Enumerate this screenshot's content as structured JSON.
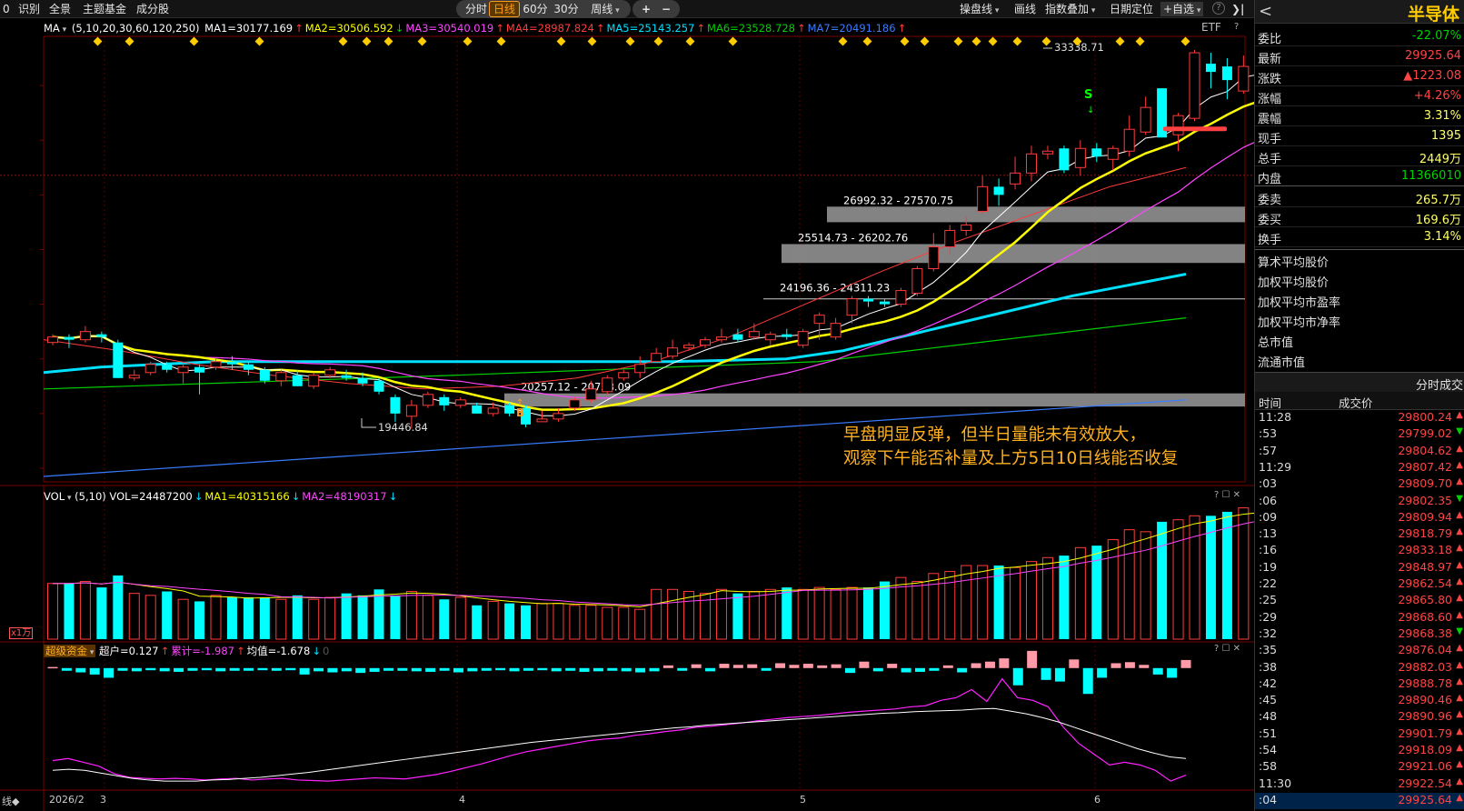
{
  "toolbar": {
    "left_items": [
      "0",
      "识别",
      "全景",
      "主题基金",
      "成分股"
    ],
    "periods": [
      "分时",
      "日线",
      "60分",
      "30分",
      "周线"
    ],
    "active_period": "日线",
    "zoom": [
      "+",
      "−"
    ],
    "right_items": [
      "操盘线",
      "画线",
      "指数叠加",
      "日期定位",
      "+自选"
    ],
    "help": "?",
    "collapse": "❯|"
  },
  "main_chart": {
    "indicator_name": "MA",
    "params": "(5,10,20,30,60,120,250)",
    "ma_values": [
      {
        "label": "MA1=30177.169",
        "arrow": "↑",
        "color": "#ffffff"
      },
      {
        "label": "MA2=30506.592",
        "arrow": "↓",
        "color": "#ffff00"
      },
      {
        "label": "MA3=30540.019",
        "arrow": "↑",
        "color": "#ff44ff"
      },
      {
        "label": "MA4=28987.824",
        "arrow": "↑",
        "color": "#ff3b3b"
      },
      {
        "label": "MA5=25143.257",
        "arrow": "↑",
        "color": "#00e0ff"
      },
      {
        "label": "MA6=23528.728",
        "arrow": "↑",
        "color": "#00d000"
      },
      {
        "label": "MA7=20491.186",
        "arrow": "↑",
        "color": "#3a7cff"
      }
    ],
    "instrument_type": "ETF",
    "y_ticks": [
      "32000",
      "30000",
      "28000",
      "26000",
      "24000",
      "22000",
      "20000",
      "18000"
    ],
    "high_label": "33338.71",
    "low_label": "19446.84",
    "zones": [
      "26992.32 - 27570.75",
      "25514.73 - 26202.76",
      "24196.36 - 24311.23",
      "20257.12 - 20738.09"
    ],
    "buy_marker": "B",
    "sell_marker": "S",
    "annotation_line1": "早盘明显反弹，但半日量能未有效放大，",
    "annotation_line2": "观察下午能否补量及上方5日10日线能否收复"
  },
  "volume_chart": {
    "indicator_name": "VOL",
    "params": "(5,10)",
    "values": [
      {
        "label": "VOL=24487200",
        "arrow": "↓",
        "color": "#ffffff"
      },
      {
        "label": "MA1=40315166",
        "arrow": "↓",
        "color": "#ffff00"
      },
      {
        "label": "MA2=48190317",
        "arrow": "↓",
        "color": "#ff44ff"
      }
    ],
    "y_ticks": [
      "6000",
      "4000",
      "2000"
    ],
    "unit_badge": "x1万"
  },
  "capital_chart": {
    "indicator_name": "超级资金",
    "values": [
      {
        "label": "超户=0.127",
        "arrow": "↑",
        "color": "#ffffff"
      },
      {
        "label": "累计=-1.987",
        "arrow": "↑",
        "color": "#ff44ff"
      },
      {
        "label": "均值=-1.678",
        "arrow": "↓",
        "color": "#ffffff"
      },
      {
        "label": "0",
        "arrow": "",
        "color": "#555555"
      }
    ],
    "y_ticks": [
      "0",
      "-1",
      "-2"
    ]
  },
  "x_axis": {
    "start_label": "2026/2",
    "labels": [
      "3",
      "4",
      "5",
      "6"
    ],
    "left_edge": "线◆"
  },
  "quote_panel": {
    "title": "半导体",
    "rows": [
      {
        "key": "委比",
        "value": "-22.07%",
        "color": "#00d000"
      },
      {
        "key": "最新",
        "value": "29925.64",
        "color": "#ff4444"
      },
      {
        "key": "涨跌",
        "value": "▲1223.08",
        "color": "#ff4444"
      },
      {
        "key": "涨幅",
        "value": "+4.26%",
        "color": "#ff4444"
      },
      {
        "key": "震幅",
        "value": "3.31%",
        "color": "#ffff66"
      },
      {
        "key": "现手",
        "value": "1395",
        "color": "#ffff66"
      },
      {
        "key": "总手",
        "value": "2449万",
        "color": "#ffff66"
      },
      {
        "key": "内盘",
        "value": "11366010",
        "color": "#00d000"
      },
      {
        "key": "委卖",
        "value": "265.7万",
        "color": "#ffff66"
      },
      {
        "key": "委买",
        "value": "169.6万",
        "color": "#ffff66"
      },
      {
        "key": "换手",
        "value": "3.14%",
        "color": "#ffff66"
      }
    ],
    "metrics": [
      "算术平均股价",
      "加权平均股价",
      "加权平均市盈率",
      "加权平均市净率",
      "总市值",
      "流通市值"
    ],
    "ticks_header": "分时成交",
    "ticks_columns": [
      "时间",
      "成交价"
    ],
    "ticks": [
      {
        "time": "11:28",
        "price": "29800.24",
        "dir": "▲"
      },
      {
        "time": ":53",
        "price": "29799.02",
        "dir": "▼"
      },
      {
        "time": ":57",
        "price": "29804.62",
        "dir": "▲"
      },
      {
        "time": "11:29",
        "price": "29807.42",
        "dir": "▲"
      },
      {
        "time": ":03",
        "price": "29809.70",
        "dir": "▲"
      },
      {
        "time": ":06",
        "price": "29802.35",
        "dir": "▼"
      },
      {
        "time": ":09",
        "price": "29809.94",
        "dir": "▲"
      },
      {
        "time": ":13",
        "price": "29818.79",
        "dir": "▲"
      },
      {
        "time": ":16",
        "price": "29833.18",
        "dir": "▲"
      },
      {
        "time": ":19",
        "price": "29848.97",
        "dir": "▲"
      },
      {
        "time": ":22",
        "price": "29862.54",
        "dir": "▲"
      },
      {
        "time": ":25",
        "price": "29865.80",
        "dir": "▲"
      },
      {
        "time": ":29",
        "price": "29868.60",
        "dir": "▲"
      },
      {
        "time": ":32",
        "price": "29868.38",
        "dir": "▼"
      },
      {
        "time": ":35",
        "price": "29876.04",
        "dir": "▲"
      },
      {
        "time": ":38",
        "price": "29882.03",
        "dir": "▲"
      },
      {
        "time": ":42",
        "price": "29888.78",
        "dir": "▲"
      },
      {
        "time": ":45",
        "price": "29890.46",
        "dir": "▲"
      },
      {
        "time": ":48",
        "price": "29890.96",
        "dir": "▲"
      },
      {
        "time": ":51",
        "price": "29901.79",
        "dir": "▲"
      },
      {
        "time": ":54",
        "price": "29918.09",
        "dir": "▲"
      },
      {
        "time": ":58",
        "price": "29921.06",
        "dir": "▲"
      },
      {
        "time": "11:30",
        "price": "29922.54",
        "dir": "▲"
      },
      {
        "time": ":04",
        "price": "29925.64",
        "dir": "▲"
      }
    ]
  },
  "chart_data": {
    "type": "candlestick",
    "instrument": "半导体",
    "ylim": [
      17500,
      33800
    ],
    "candles": [
      [
        22600,
        22800,
        22500,
        22900
      ],
      [
        22800,
        22700,
        22400,
        22900
      ],
      [
        22700,
        23000,
        22600,
        23200
      ],
      [
        22900,
        22800,
        22600,
        23000
      ],
      [
        22600,
        21300,
        21300,
        22700
      ],
      [
        21300,
        21400,
        21200,
        21600
      ],
      [
        21500,
        21800,
        21400,
        21900
      ],
      [
        21800,
        21600,
        21500,
        21900
      ],
      [
        21500,
        21700,
        21100,
        21900
      ],
      [
        21700,
        21500,
        20700,
        21800
      ],
      [
        21700,
        21900,
        21600,
        22000
      ],
      [
        21900,
        21800,
        21600,
        22100
      ],
      [
        21800,
        21600,
        21400,
        21900
      ],
      [
        21600,
        21200,
        21100,
        21700
      ],
      [
        21200,
        21500,
        21000,
        21600
      ],
      [
        21400,
        21000,
        21000,
        21600
      ],
      [
        21000,
        21400,
        20900,
        21500
      ],
      [
        21400,
        21600,
        21300,
        21700
      ],
      [
        21400,
        21300,
        21200,
        21600
      ],
      [
        21300,
        21100,
        21000,
        21500
      ],
      [
        21200,
        20800,
        20700,
        21300
      ],
      [
        20600,
        20000,
        19700,
        20700
      ],
      [
        19900,
        20300,
        19450,
        20500
      ],
      [
        20300,
        20700,
        20200,
        20800
      ],
      [
        20600,
        20300,
        20100,
        20700
      ],
      [
        20300,
        20500,
        20200,
        20600
      ],
      [
        20300,
        20000,
        20000,
        20400
      ],
      [
        20000,
        20200,
        19900,
        20400
      ],
      [
        20300,
        20000,
        19900,
        20400
      ],
      [
        20200,
        19600,
        19500,
        20300
      ],
      [
        19700,
        19800,
        19700,
        20100
      ],
      [
        19800,
        20000,
        19700,
        20200
      ],
      [
        20200,
        20500,
        20100,
        20600
      ],
      [
        20500,
        20900,
        20400,
        21200
      ],
      [
        20800,
        21300,
        20700,
        21400
      ],
      [
        21300,
        21500,
        21200,
        21600
      ],
      [
        21500,
        21800,
        21300,
        22100
      ],
      [
        21900,
        22200,
        21900,
        22400
      ],
      [
        22100,
        22400,
        22000,
        22700
      ],
      [
        22400,
        22500,
        22300,
        22600
      ],
      [
        22500,
        22700,
        22400,
        22800
      ],
      [
        22700,
        22800,
        22600,
        23100
      ],
      [
        22900,
        22700,
        22600,
        23100
      ],
      [
        22800,
        23000,
        22700,
        23300
      ],
      [
        22700,
        22900,
        22500,
        23000
      ],
      [
        22900,
        22800,
        22700,
        23100
      ],
      [
        22500,
        23000,
        22400,
        23100
      ],
      [
        23300,
        23600,
        22700,
        23700
      ],
      [
        22800,
        23300,
        22700,
        23500
      ],
      [
        23600,
        24200,
        23300,
        24300
      ],
      [
        24200,
        24100,
        23900,
        24300
      ],
      [
        24100,
        24000,
        23900,
        24200
      ],
      [
        24000,
        24500,
        23900,
        24600
      ],
      [
        24400,
        25300,
        24300,
        25400
      ],
      [
        25300,
        26100,
        25200,
        26600
      ],
      [
        26100,
        26700,
        25800,
        26900
      ],
      [
        26700,
        26900,
        26500,
        27200
      ],
      [
        27400,
        28300,
        27300,
        28700
      ],
      [
        28300,
        28000,
        27600,
        28600
      ],
      [
        28400,
        28800,
        28200,
        29400
      ],
      [
        28800,
        29500,
        28500,
        29800
      ],
      [
        29500,
        29600,
        29300,
        29800
      ],
      [
        29700,
        28900,
        28800,
        29800
      ],
      [
        29000,
        29700,
        28700,
        30000
      ],
      [
        29700,
        29400,
        29200,
        29900
      ],
      [
        29300,
        29700,
        28900,
        29800
      ],
      [
        29600,
        30400,
        29400,
        30900
      ],
      [
        30300,
        31200,
        30200,
        31600
      ],
      [
        31900,
        30100,
        30100,
        31900
      ],
      [
        30200,
        30900,
        29600,
        31000
      ],
      [
        30800,
        33200,
        30700,
        33300
      ],
      [
        32800,
        32500,
        31900,
        33200
      ],
      [
        32700,
        32200,
        31500,
        33000
      ],
      [
        31800,
        32700,
        31700,
        33100
      ],
      [
        32700,
        31500,
        31500,
        33100
      ],
      [
        31500,
        32700,
        31200,
        33300
      ],
      [
        32800,
        30900,
        30900,
        32900
      ],
      [
        30800,
        29200,
        29100,
        30900
      ],
      [
        29700,
        29900,
        28800,
        30200
      ],
      [
        29900,
        30500,
        29800,
        30900
      ],
      [
        30300,
        31100,
        30200,
        31200
      ],
      [
        31200,
        30900,
        30700,
        31500
      ],
      [
        30800,
        30300,
        30300,
        31000
      ],
      [
        28700,
        28400,
        28300,
        29100
      ],
      [
        29400,
        29800,
        29300,
        29900
      ]
    ],
    "volume": [
      2800,
      2800,
      2900,
      2600,
      3200,
      2300,
      2200,
      2400,
      2000,
      1900,
      2200,
      2100,
      2100,
      2100,
      2000,
      2200,
      2000,
      2100,
      2300,
      2200,
      2500,
      2200,
      2400,
      2200,
      2000,
      2100,
      1700,
      1900,
      1800,
      1700,
      1800,
      1800,
      1700,
      1700,
      1600,
      1600,
      1500,
      2500,
      2500,
      2400,
      2300,
      2500,
      2300,
      2400,
      2500,
      2600,
      2500,
      2600,
      2500,
      2600,
      2600,
      2900,
      3100,
      2900,
      3300,
      3400,
      3700,
      3700,
      3700,
      3600,
      3900,
      4100,
      4200,
      4600,
      4700,
      5000,
      5500,
      5400,
      5900,
      6000,
      6200,
      6200,
      6400,
      6600,
      6400,
      6500,
      6800,
      5900,
      5700,
      5400,
      5000,
      4800,
      4700,
      4300,
      2400
    ],
    "capital_bars": [
      0.02,
      -0.05,
      -0.08,
      -0.12,
      -0.18,
      -0.05,
      -0.06,
      -0.04,
      -0.06,
      -0.07,
      -0.05,
      -0.04,
      -0.06,
      -0.05,
      -0.05,
      -0.04,
      -0.05,
      -0.04,
      -0.12,
      -0.06,
      -0.08,
      -0.06,
      -0.09,
      -0.07,
      -0.05,
      -0.05,
      -0.06,
      -0.07,
      -0.05,
      -0.08,
      -0.06,
      -0.05,
      -0.04,
      -0.06,
      -0.05,
      -0.04,
      -0.06,
      -0.05,
      -0.07,
      -0.06,
      -0.05,
      -0.06,
      -0.08,
      -0.06,
      0.05,
      -0.05,
      0.07,
      -0.06,
      0.08,
      0.06,
      0.07,
      -0.05,
      0.09,
      0.06,
      0.08,
      0.05,
      0.07,
      -0.09,
      0.12,
      -0.06,
      0.08,
      -0.08,
      -0.07,
      -0.05,
      0.05,
      -0.08,
      0.09,
      0.12,
      0.18,
      -0.32,
      0.32,
      -0.22,
      -0.25,
      0.16,
      -0.48,
      -0.18,
      0.09,
      0.11,
      0.06,
      -0.12,
      -0.18,
      0.15
    ],
    "capital_cum": [
      -1.72,
      -1.68,
      -1.75,
      -1.82,
      -1.96,
      -2.03,
      -2.05,
      -2.06,
      -2.05,
      -2.06,
      -2.08,
      -2.06,
      -2.05,
      -2.08,
      -2.06,
      -2.05,
      -2.08,
      -2.09,
      -2.1,
      -2.08,
      -2.06,
      -2.04,
      -2.05,
      -2.06,
      -2.02,
      -1.98,
      -1.92,
      -1.85,
      -1.78,
      -1.7,
      -1.62,
      -1.55,
      -1.5,
      -1.45,
      -1.4,
      -1.35,
      -1.32,
      -1.3,
      -1.25,
      -1.22,
      -1.18,
      -1.15,
      -1.1,
      -1.08,
      -1.05,
      -1.02,
      -0.98,
      -0.95,
      -0.92,
      -0.9,
      -0.88,
      -0.85,
      -0.82,
      -0.8,
      -0.78,
      -0.76,
      -0.72,
      -0.7,
      -0.6,
      -0.55,
      -0.4,
      -0.62,
      -0.2,
      -0.55,
      -0.6,
      -0.72,
      -1.1,
      -1.4,
      -1.6,
      -1.8,
      -1.75,
      -1.8,
      -1.9,
      -2.1,
      -1.99
    ],
    "capital_avg": [
      -1.9,
      -1.88,
      -1.9,
      -1.95,
      -2.0,
      -2.05,
      -2.08,
      -2.1,
      -2.1,
      -2.1,
      -2.08,
      -2.07,
      -2.05,
      -2.03,
      -2.0,
      -1.97,
      -1.94,
      -1.9,
      -1.86,
      -1.82,
      -1.78,
      -1.74,
      -1.7,
      -1.66,
      -1.62,
      -1.58,
      -1.54,
      -1.5,
      -1.46,
      -1.42,
      -1.38,
      -1.35,
      -1.32,
      -1.29,
      -1.26,
      -1.23,
      -1.2,
      -1.17,
      -1.14,
      -1.11,
      -1.09,
      -1.06,
      -1.04,
      -1.02,
      -1.0,
      -0.98,
      -0.96,
      -0.94,
      -0.92,
      -0.9,
      -0.88,
      -0.86,
      -0.84,
      -0.83,
      -0.81,
      -0.8,
      -0.79,
      -0.78,
      -0.76,
      -0.75,
      -0.8,
      -0.85,
      -0.92,
      -1.0,
      -1.1,
      -1.2,
      -1.3,
      -1.4,
      -1.5,
      -1.58,
      -1.65,
      -1.68
    ],
    "ma_lines": {
      "ma250": {
        "start": 17700,
        "end": 20500,
        "color": "#3a7cff"
      },
      "ma120": {
        "start": 20900,
        "end": 23500,
        "color": "#00d000"
      },
      "ma60": {
        "points": [
          21500,
          21700,
          21800,
          21900,
          21900,
          21900,
          21900,
          21900,
          21900,
          21900,
          21900,
          21900,
          21950,
          22000,
          22300,
          22800,
          23300,
          23800,
          24300,
          24700,
          25100
        ],
        "color": "#00e0ff"
      },
      "ma30": {
        "points": [
          22700,
          22300,
          21800,
          21400,
          21100,
          20900,
          21000,
          21300,
          21900,
          22800,
          24000,
          25200,
          26300,
          27300,
          28300,
          29000
        ],
        "color": "#ff3b3b"
      }
    }
  }
}
